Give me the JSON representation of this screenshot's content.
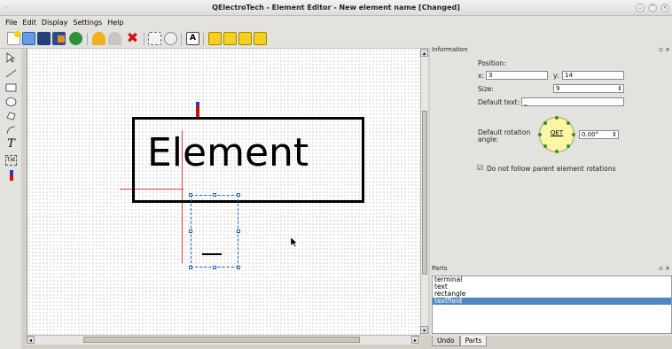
{
  "window": {
    "title": "QElectroTech - Element Editor - New element name [Changed]",
    "app_glyph": "◦",
    "buttons": [
      "⌄",
      "^",
      "×"
    ]
  },
  "menubar": {
    "items": [
      "File",
      "Edit",
      "Display",
      "Settings",
      "Help"
    ]
  },
  "toolbar": {
    "icons": [
      "new-icon",
      "open-icon",
      "save-icon",
      "save-as-icon",
      "reload-icon",
      "undo-icon",
      "redo-icon",
      "delete-icon",
      "select-all-icon",
      "zoom-icon",
      "edit-names-icon",
      "raise-icon",
      "lower-icon",
      "bring-front-icon",
      "send-back-icon"
    ]
  },
  "tools": {
    "icons": [
      "pointer-icon",
      "line-icon",
      "rectangle-icon",
      "ellipse-icon",
      "polygon-icon",
      "arc-icon",
      "text-icon",
      "textfield-icon",
      "terminal-icon"
    ],
    "text_tool_glyph": "T",
    "textfield_tool_glyph": "Txt"
  },
  "canvas": {
    "element_text": "Element",
    "accent": "#000000",
    "scroll": {
      "left": "◂",
      "right": "▸",
      "up": "▴",
      "down": "▾"
    }
  },
  "information": {
    "title": "Information",
    "controls": "▫ ×",
    "position_label": "Position:",
    "x_label": "x:",
    "x_value": "3",
    "y_label": "y:",
    "y_value": "14",
    "size_label": "Size:",
    "size_value": "9",
    "spin": "⇕",
    "default_text_label": "Default text:",
    "default_text_value": "_",
    "rotation_label_1": "Default rotation",
    "rotation_label_2": "angle:",
    "rotation_dial_text": "QET",
    "rotation_value": "0.00°",
    "checkbox_mark": "☑",
    "follow_label": "Do not follow parent element rotations",
    "follow_checked": true
  },
  "parts": {
    "title": "Parts",
    "controls": "▫ ×",
    "items": [
      "terminal",
      "text",
      "rectangle",
      "textfield"
    ],
    "selected_index": 3
  },
  "tabs": [
    "Undo",
    "Parts"
  ]
}
